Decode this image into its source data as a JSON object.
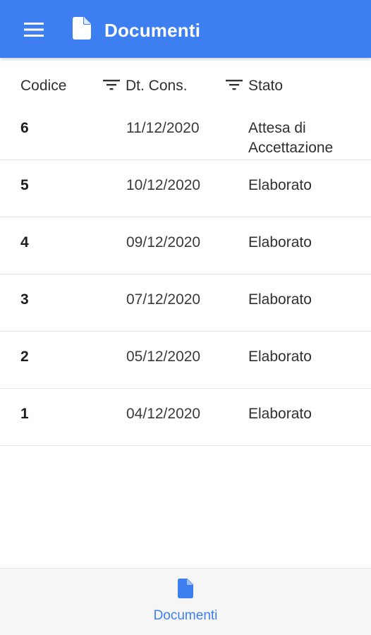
{
  "appbar": {
    "title": "Documenti",
    "menu_icon": "menu-icon",
    "title_icon": "document-icon",
    "color": "#3d7ff0"
  },
  "table": {
    "columns": {
      "code": "Codice",
      "date": "Dt. Cons.",
      "state": "Stato"
    },
    "rows": [
      {
        "code": "6",
        "date": "11/12/2020",
        "state": "Attesa di Accettazione"
      },
      {
        "code": "5",
        "date": "10/12/2020",
        "state": "Elaborato"
      },
      {
        "code": "4",
        "date": "09/12/2020",
        "state": "Elaborato"
      },
      {
        "code": "3",
        "date": "07/12/2020",
        "state": "Elaborato"
      },
      {
        "code": "2",
        "date": "05/12/2020",
        "state": "Elaborato"
      },
      {
        "code": "1",
        "date": "04/12/2020",
        "state": "Elaborato"
      }
    ]
  },
  "bottom_nav": {
    "items": [
      {
        "label": "Documenti",
        "icon": "document-icon",
        "active": true
      }
    ],
    "active_color": "#3d7ff0"
  }
}
